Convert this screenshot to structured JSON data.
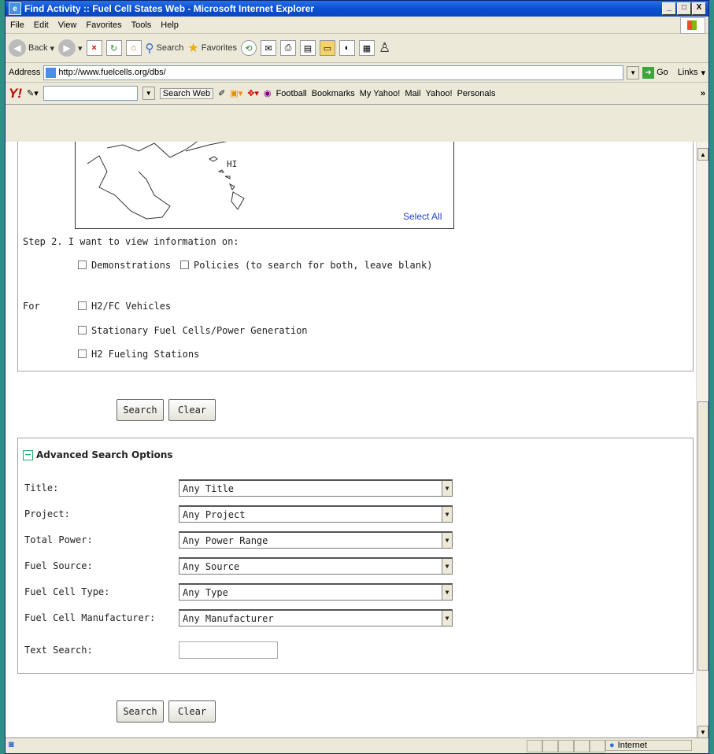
{
  "window": {
    "title": "Find Activity :: Fuel Cell States Web - Microsoft Internet Explorer",
    "btn_min": "_",
    "btn_max": "□",
    "btn_close": "X"
  },
  "menu": [
    "File",
    "Edit",
    "View",
    "Favorites",
    "Tools",
    "Help"
  ],
  "toolbar": {
    "back": "Back",
    "search": "Search",
    "favorites": "Favorites"
  },
  "address": {
    "label": "Address",
    "url": "http://www.fuelcells.org/dbs/",
    "go": "Go",
    "links": "Links"
  },
  "yahoo_toolbar": {
    "logo": "Y!",
    "search_web": "Search Web",
    "items": [
      "Football",
      "Bookmarks",
      "My Yahoo!",
      "Mail",
      "Yahoo!",
      "Personals"
    ]
  },
  "map": {
    "state_label": "HI",
    "select_all": "Select All"
  },
  "step2": {
    "heading": "Step 2.  I want to view information on:",
    "demonstrations": "Demonstrations",
    "policies": "Policies  (to search for both, leave blank)",
    "for_label": "For",
    "options": [
      "H2/FC Vehicles",
      "Stationary Fuel Cells/Power Generation",
      "H2 Fueling Stations"
    ]
  },
  "buttons": {
    "search": "Search",
    "clear": "Clear"
  },
  "advanced": {
    "toggle": "−",
    "heading": "Advanced Search Options",
    "fields": [
      {
        "label": "Title:",
        "value": "Any Title"
      },
      {
        "label": "Project:",
        "value": "Any Project"
      },
      {
        "label": "Total Power:",
        "value": "Any Power Range"
      },
      {
        "label": "Fuel Source:",
        "value": "Any Source"
      },
      {
        "label": "Fuel Cell Type:",
        "value": "Any Type"
      },
      {
        "label": "Fuel Cell Manufacturer:",
        "value": "Any Manufacturer"
      }
    ],
    "text_search_label": "Text Search:",
    "text_search_value": ""
  },
  "status": {
    "zone": "Internet"
  }
}
